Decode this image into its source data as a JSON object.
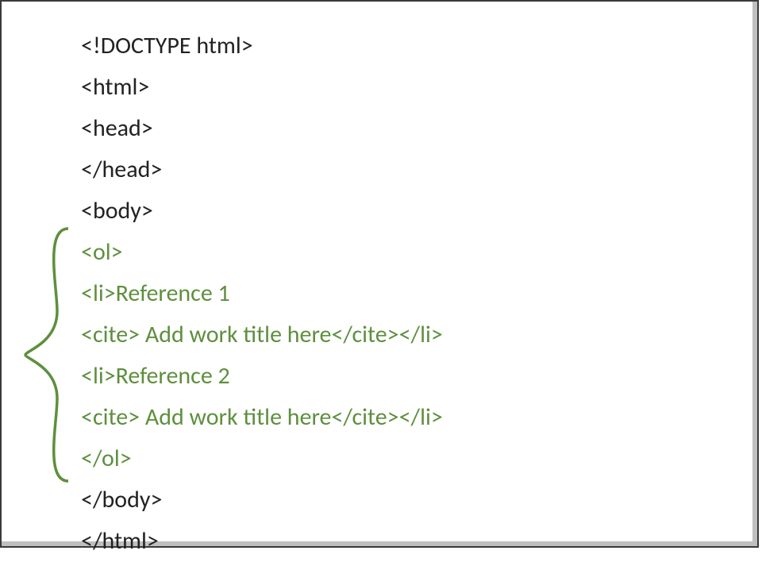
{
  "code": {
    "l1": "<!DOCTYPE html>",
    "l2": "<html>",
    "l3": "<head>",
    "l4": "</head>",
    "l5": "<body>",
    "l6": "<ol>",
    "l7": "<li>Reference 1",
    "l8": "<cite> Add work title here</cite></li>",
    "l9": "<li>Reference 2",
    "l10": "<cite> Add work title here</cite></li>",
    "l11": "</ol>",
    "l12": "</body>",
    "l13": "</html>"
  },
  "colors": {
    "highlight": "#5e8f3e",
    "normal": "#222222",
    "brace": "#5e8f3e"
  }
}
